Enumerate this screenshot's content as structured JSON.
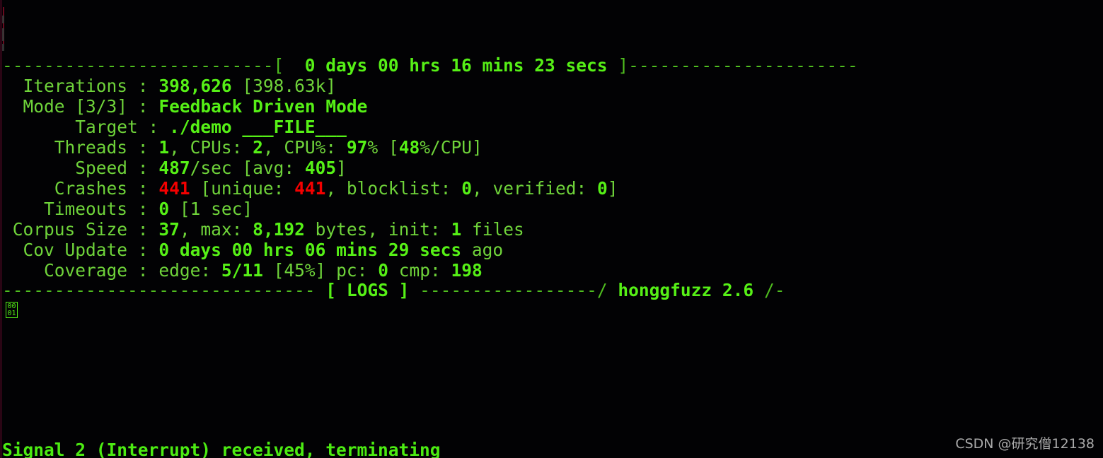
{
  "terminal": {
    "app": "honggfuzz",
    "version_footer": "honggfuzz 2.6",
    "colors": {
      "background": "#020204",
      "green_label": "#6fd33a",
      "green_value": "#56f016",
      "red_value": "#f40000",
      "rule": "#4fbd1f",
      "watermark": "#b9b9b9"
    },
    "header": {
      "left_rule": "--------------------------",
      "open_bracket": "[",
      "elapsed": "0 days 00 hrs 16 mins 23 secs",
      "close_bracket": "]",
      "right_rule": "----------------------"
    },
    "stats": {
      "iterations": {
        "label": "Iterations",
        "sep": ":",
        "value": "398,626",
        "suffix": "[398.63k]"
      },
      "mode": {
        "label": "Mode [3/3]",
        "sep": ":",
        "value": "Feedback Driven Mode"
      },
      "target": {
        "label": "Target",
        "sep": ":",
        "value": "./demo",
        "file_token": "___FILE___"
      },
      "threads": {
        "label": "Threads",
        "sep": ":",
        "threads_count": "1",
        "cpus_label": ", CPUs:",
        "cpus_count": "2",
        "cpu_pct_label": ", CPU%:",
        "cpu_pct": "97",
        "pct_sign": "%",
        "per_cpu_open": "[",
        "per_cpu": "48",
        "per_cpu_suffix": "%/CPU]"
      },
      "speed": {
        "label": "Speed",
        "sep": ":",
        "value": "487",
        "unit": "/sec",
        "avg_open": "[avg:",
        "avg": "405",
        "avg_close": "]"
      },
      "crashes": {
        "label": "Crashes",
        "sep": ":",
        "count": "441",
        "unique_open": "[unique:",
        "unique": "441",
        "blocklist_label": ", blocklist:",
        "blocklist": "0",
        "verified_label": ", verified:",
        "verified": "0",
        "close": "]"
      },
      "timeouts": {
        "label": "Timeouts",
        "sep": ":",
        "value": "0",
        "suffix": "[1 sec]"
      },
      "corpus": {
        "label": "Corpus Size",
        "sep": ":",
        "size": "37",
        "max_label": ", max:",
        "max": "8,192",
        "bytes_label": "bytes, init:",
        "init": "1",
        "files_label": "files"
      },
      "cov_update": {
        "label": "Cov Update",
        "sep": ":",
        "value": "0 days 00 hrs 06 mins 29 secs",
        "suffix": "ago"
      },
      "coverage": {
        "label": "Coverage",
        "sep": ":",
        "edge_label": "edge:",
        "edge": "5/11",
        "edge_pct": "[45%]",
        "pc_label": "pc:",
        "pc": "0",
        "cmp_label": "cmp:",
        "cmp": "198"
      }
    },
    "logs_divider": {
      "left_rule": "------------------------------",
      "open_bracket": "[",
      "title": "LOGS",
      "close_bracket": "]",
      "right_rule": "-----------------/",
      "brand": "honggfuzz 2.6",
      "tail": "/-"
    },
    "log_glyph": {
      "name": "unicode-tofu-box",
      "top_hex": "00",
      "bottom_hex": "01"
    },
    "messages": {
      "signal": "Signal 2 (Interrupt) received, terminating"
    },
    "watermark": "CSDN @研究僧12138"
  }
}
